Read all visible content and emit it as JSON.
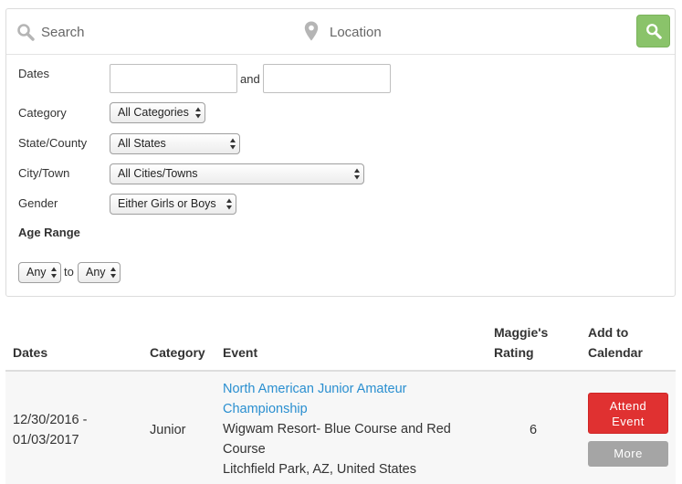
{
  "search": {
    "placeholder": "Search"
  },
  "location": {
    "placeholder": "Location"
  },
  "filters": {
    "dates_label": "Dates",
    "and_label": "and",
    "date_from": "",
    "date_to": "",
    "category_label": "Category",
    "category_value": "All Categories",
    "state_label": "State/County",
    "state_value": "All States",
    "city_label": "City/Town",
    "city_value": "All Cities/Towns",
    "gender_label": "Gender",
    "gender_value": "Either Girls or Boys",
    "age_range_heading": "Age Range",
    "age_min_value": "Any",
    "to_label": "to",
    "age_max_value": "Any"
  },
  "table": {
    "headers": {
      "dates": "Dates",
      "category": "Category",
      "event": "Event",
      "rating_line1": "Maggie's",
      "rating_line2": "Rating",
      "calendar_line1": "Add to",
      "calendar_line2": "Calendar"
    },
    "rows": [
      {
        "date_start": "12/30/2016 -",
        "date_end": "01/03/2017",
        "category": "Junior",
        "event_title_line1": "North American Junior Amateur",
        "event_title_line2": "Championship",
        "venue_line1": "Wigwam Resort- Blue Course and Red",
        "venue_line2": "Course",
        "location": "Litchfield Park, AZ, United States",
        "rating": "6",
        "attend_line1": "Attend",
        "attend_line2": "Event",
        "more_label": "More"
      }
    ]
  },
  "colors": {
    "search_button": "#8ac36a",
    "attend_button": "#e03131",
    "more_button": "#a5a5a5",
    "link": "#2a8fd0"
  },
  "icons": {
    "search": "search-icon",
    "location": "map-pin-icon",
    "go": "search-icon",
    "select_arrows": "updown-arrows-icon"
  }
}
